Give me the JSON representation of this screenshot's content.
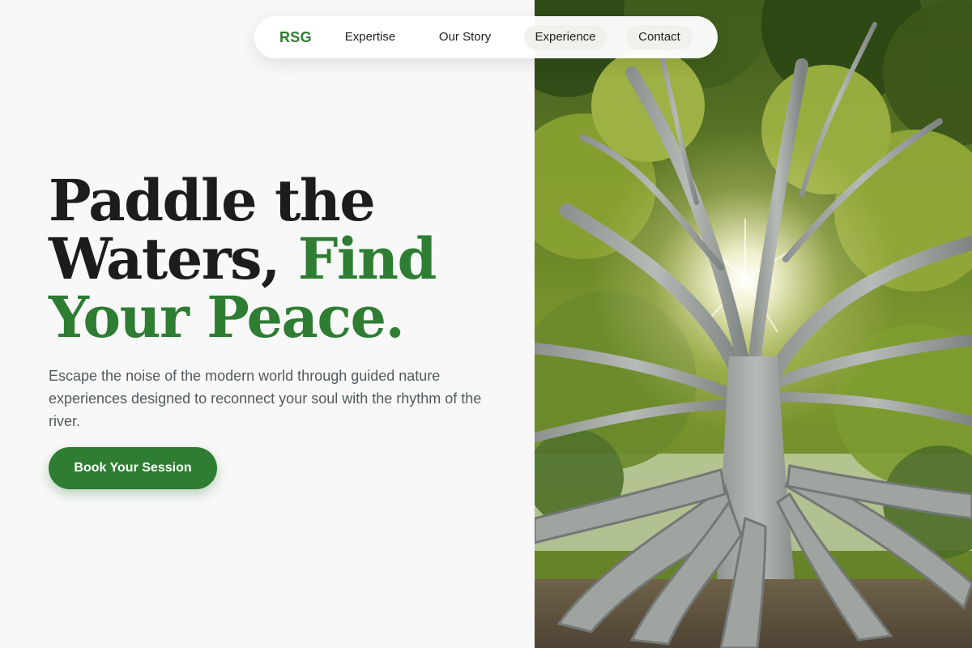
{
  "nav": {
    "logo": "RSG",
    "links": [
      {
        "label": "Expertise"
      },
      {
        "label": "Our Story"
      },
      {
        "label": "Experience"
      },
      {
        "label": "Contact"
      }
    ]
  },
  "hero": {
    "headline_line1": "Paddle the",
    "headline_line2_dark": "Waters, ",
    "headline_line2_green": "Find",
    "headline_line3": "Your Peace.",
    "subtext": "Escape the noise of the modern world through guided nature experiences designed to reconnect your soul with the rhythm of the river.",
    "cta_label": "Book Your Session"
  },
  "colors": {
    "brand_green": "#2e7d32",
    "headline_dark": "#1c1c1c",
    "body_text": "#505a5f",
    "page_background": "#f8f8f8"
  },
  "icons": {
    "hero_image": "banyan-tree-photo"
  }
}
